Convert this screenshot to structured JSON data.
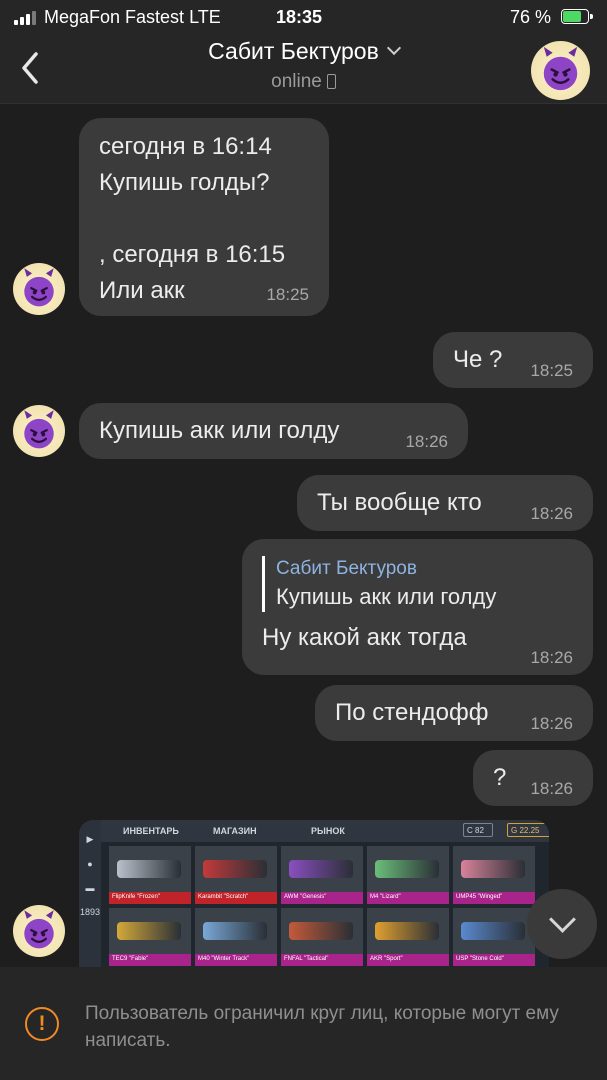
{
  "status_bar": {
    "carrier": "MegaFon Fastest  LTE",
    "time": "18:35",
    "battery": "76 %",
    "battery_level": 0.76
  },
  "header": {
    "back_icon": "chevron-left-icon",
    "title": "Сабит Бектуров",
    "status": "online",
    "dropdown_icon": "chevron-down-icon"
  },
  "messages": [
    {
      "dir": "in",
      "text": "сегодня в 16:14\nКупишь голды?\n\n, сегодня в 16:15\nИли акк",
      "time": "18:25"
    },
    {
      "dir": "out",
      "text": "Че ?",
      "time": "18:25"
    },
    {
      "dir": "in",
      "text": "Купишь акк или голду",
      "time": "18:26"
    },
    {
      "dir": "out",
      "text": "Ты вообще кто",
      "time": "18:26"
    },
    {
      "dir": "out",
      "reply_name": "Сабит Бектуров",
      "reply_text": "Купишь акк или голду",
      "text": "Ну какой акк тогда",
      "time": "18:26"
    },
    {
      "dir": "out",
      "text": "По стендофф",
      "time": "18:26"
    },
    {
      "dir": "out",
      "text": "?",
      "time": "18:26"
    }
  ],
  "attachment": {
    "tabs": [
      "ИНВЕНТАРЬ",
      "МАГАЗИН",
      "РЫНОК"
    ],
    "currency_silver": "82",
    "currency_gold": "22.25",
    "side_value": "1893",
    "items": [
      {
        "name": "FlipKnife \"Frozen\"",
        "color": "#c0242a",
        "gun": "#b9c2cc"
      },
      {
        "name": "Karambit \"Scratch\"",
        "color": "#c0242a",
        "gun": "#c23a3a"
      },
      {
        "name": "AWM \"Genesis\"",
        "color": "#a8248a",
        "gun": "#8a4fc0"
      },
      {
        "name": "M4 \"Lizard\"",
        "color": "#a8248a",
        "gun": "#6bbf7a"
      },
      {
        "name": "UMP45 \"Winged\"",
        "color": "#a8248a",
        "gun": "#d8839a"
      },
      {
        "name": "TEC9 \"Fable\"",
        "color": "#a8248a",
        "gun": "#d4a93a"
      },
      {
        "name": "M40 \"Winter Track\"",
        "color": "#a8248a",
        "gun": "#7aa8d8"
      },
      {
        "name": "FNFAL \"Tactical\"",
        "color": "#a8248a",
        "gun": "#c45a3a"
      },
      {
        "name": "AKR \"Sport\"",
        "color": "#a8248a",
        "gun": "#e0a030"
      },
      {
        "name": "USP \"Stone Cold\"",
        "color": "#a8248a",
        "gun": "#5a8ad0"
      }
    ]
  },
  "notice": {
    "icon": "warning-icon",
    "text": "Пользователь ограничил круг лиц, которые могут ему написать."
  }
}
